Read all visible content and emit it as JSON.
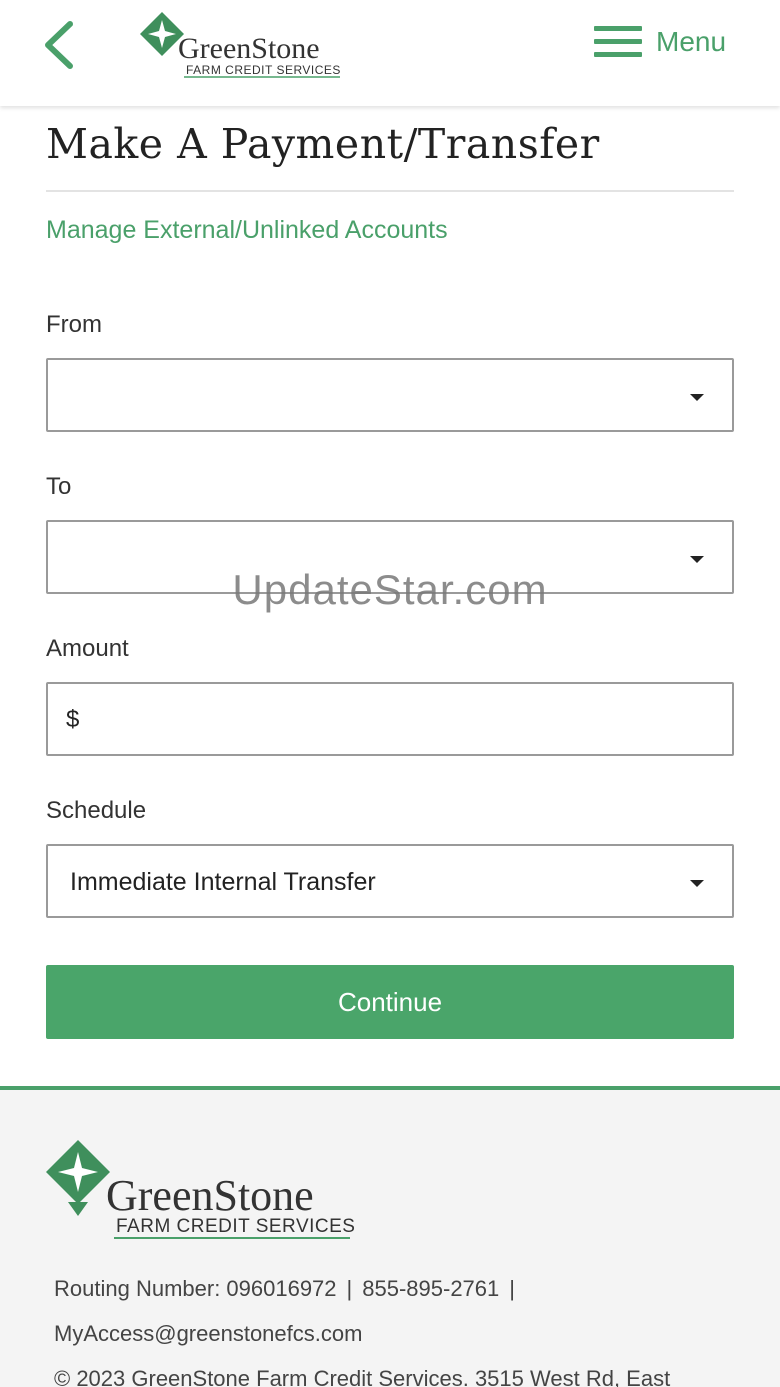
{
  "header": {
    "logo_name": "GreenStone",
    "logo_sub": "FARM CREDIT SERVICES",
    "menu_label": "Menu"
  },
  "page": {
    "title": "Make A Payment/Transfer",
    "external_link": "Manage External/Unlinked Accounts"
  },
  "form": {
    "from_label": "From",
    "from_value": "",
    "to_label": "To",
    "to_value": "",
    "amount_label": "Amount",
    "amount_prefix": "$",
    "amount_value": "",
    "schedule_label": "Schedule",
    "schedule_value": "Immediate Internal Transfer",
    "continue_label": "Continue"
  },
  "watermark": "UpdateStar.com",
  "footer": {
    "logo_name": "GreenStone",
    "logo_sub": "FARM CREDIT SERVICES",
    "routing": "Routing Number: 096016972",
    "separator": "|",
    "phone": "855-895-2761",
    "email": "MyAccess@greenstonefcs.com",
    "copyright": "© 2023 GreenStone Farm Credit Services. 3515 West Rd, East"
  },
  "colors": {
    "brand_green": "#4aa06a",
    "button_green": "#4aa56a"
  },
  "icons": [
    "back-chevron-icon",
    "hamburger-menu-icon",
    "dropdown-caret-icon",
    "leaf-logo-icon"
  ]
}
